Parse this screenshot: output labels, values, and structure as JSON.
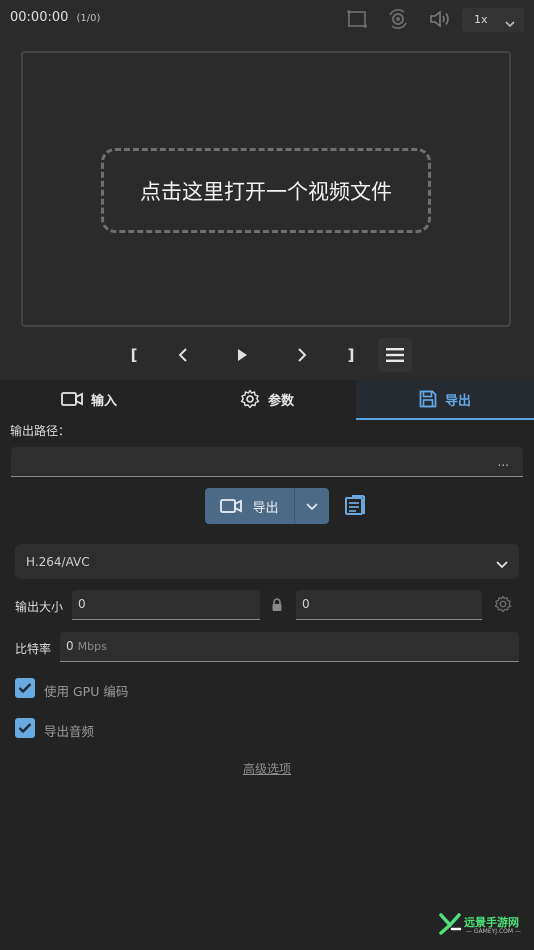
{
  "player": {
    "timecode": "00:00:00",
    "frame_count": "(1/0)",
    "speed": "1x",
    "drop_zone_text": "点击这里打开一个视频文件"
  },
  "transport": {
    "mark_in": "[",
    "mark_out": "]"
  },
  "tabs": [
    {
      "label": "输入",
      "icon": "video-camera-icon"
    },
    {
      "label": "参数",
      "icon": "gear-icon"
    },
    {
      "label": "导出",
      "icon": "floppy-disk-icon",
      "active": true
    }
  ],
  "export": {
    "output_path_label": "输出路径：",
    "output_path_value": "",
    "browse_label": "...",
    "export_button_label": "导出",
    "codec": "H.264/AVC",
    "output_size_label": "输出大小",
    "width_value": "0",
    "height_value": "0",
    "bitrate_label": "比特率",
    "bitrate_value": "0",
    "bitrate_unit": "Mbps",
    "use_gpu_label": "使用 GPU 编码",
    "use_gpu_checked": true,
    "export_audio_label": "导出音频",
    "export_audio_checked": true,
    "advanced_label": "高级选项"
  },
  "watermark": {
    "text": "远景手游网",
    "sub": "— GAMEYJ.COM —"
  },
  "colors": {
    "accent": "#64a8e8",
    "export_button": "#4b6a87",
    "checkbox": "#6aa8e0",
    "watermark": "#4fe07a"
  }
}
